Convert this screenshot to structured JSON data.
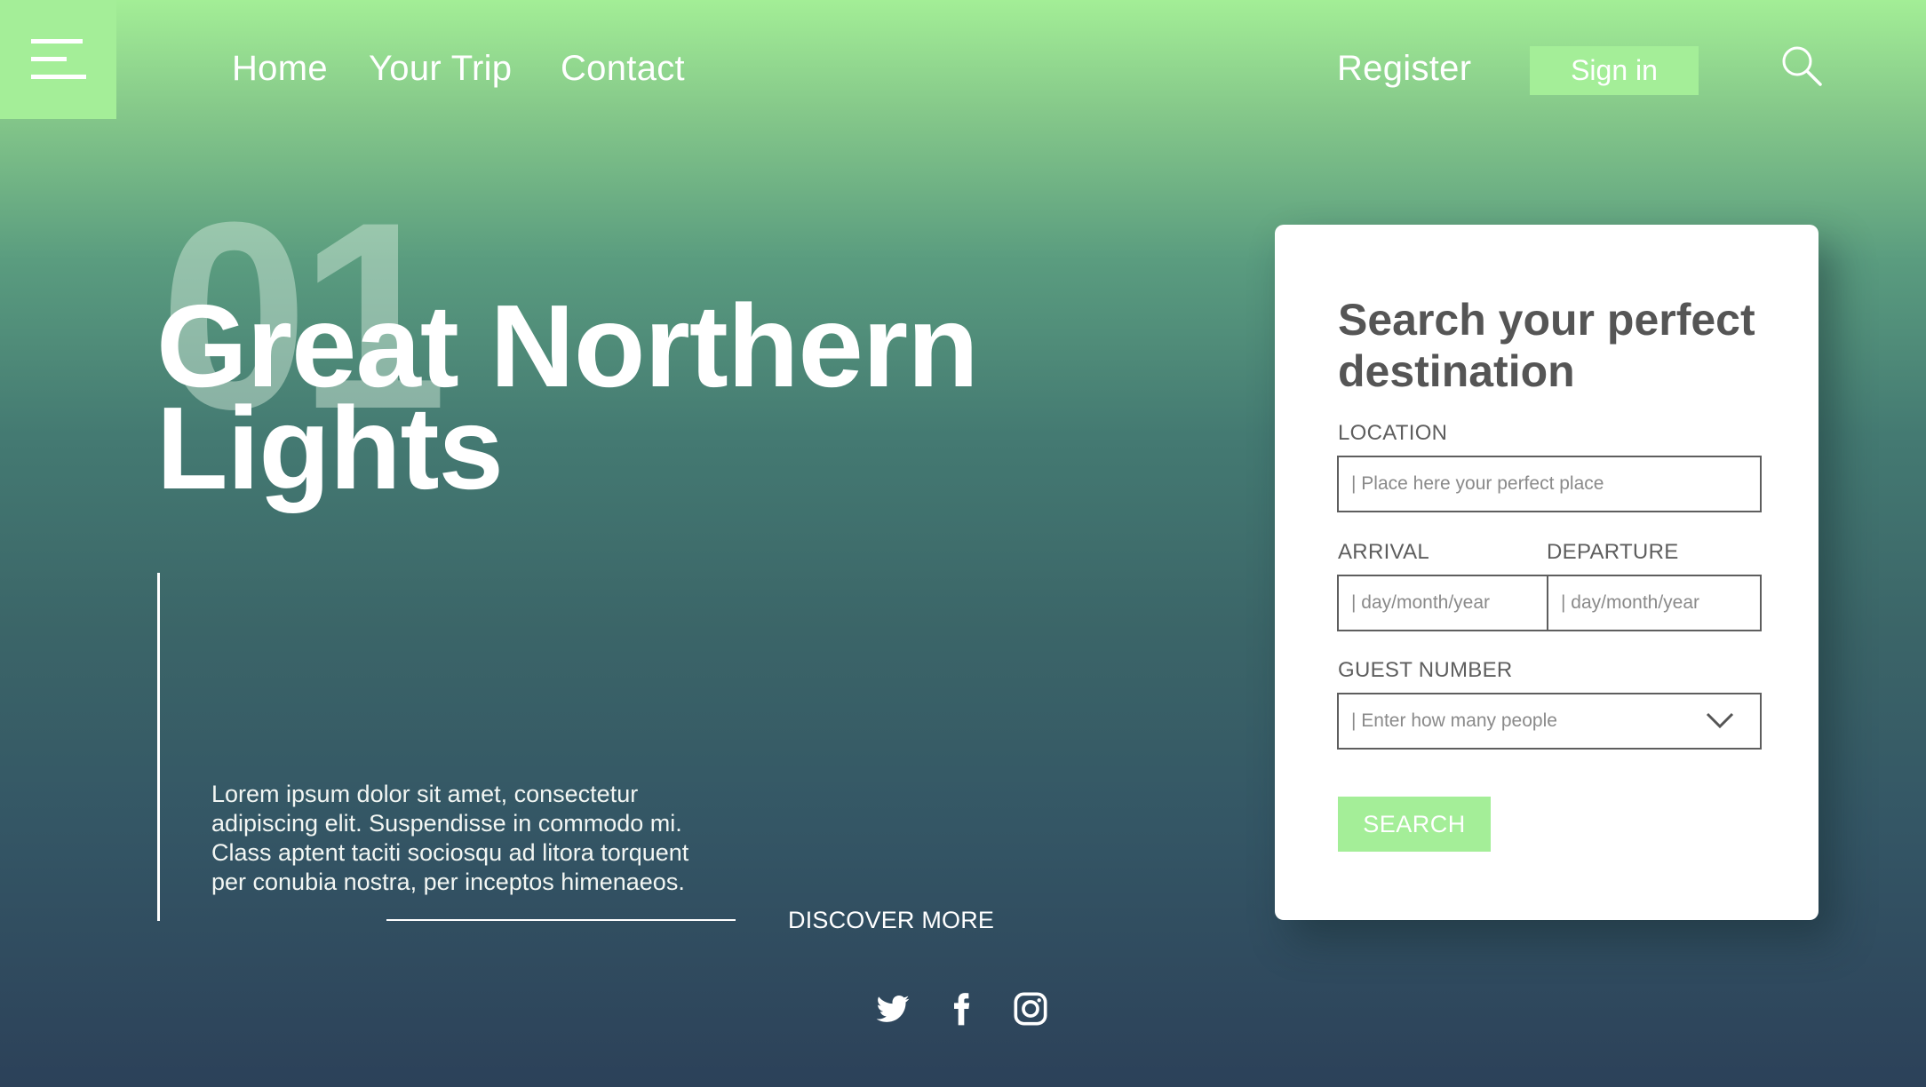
{
  "colors": {
    "accent": "#a4ee98",
    "card_text": "#555555",
    "background_top": "#a3ee96",
    "background_bottom": "#2c4159"
  },
  "header": {
    "menu_icon": "hamburger-icon",
    "nav": [
      "Home",
      "Your Trip",
      "Contact"
    ],
    "register_label": "Register",
    "signin_label": "Sign in",
    "search_icon": "search-icon"
  },
  "hero": {
    "number": "01",
    "title_line1": "Great Northern",
    "title_line2": "Lights",
    "description": "Lorem ipsum dolor sit amet, consectetur adipiscing elit. Suspendisse in commodo mi. Class aptent taciti sociosqu ad litora torquent per conubia nostra, per inceptos himenaeos.",
    "discover_label": "DISCOVER MORE"
  },
  "social": {
    "icons": [
      "twitter-icon",
      "facebook-icon",
      "instagram-icon"
    ]
  },
  "search_card": {
    "title": "Search your perfect destination",
    "location_label": "LOCATION",
    "location_placeholder": "| Place here your perfect place",
    "arrival_label": "ARRIVAL",
    "arrival_placeholder": "| day/month/year",
    "departure_label": "DEPARTURE",
    "departure_placeholder": "| day/month/year",
    "guest_label": "GUEST NUMBER",
    "guest_value": "| Enter how many people",
    "search_label": "SEARCH"
  }
}
